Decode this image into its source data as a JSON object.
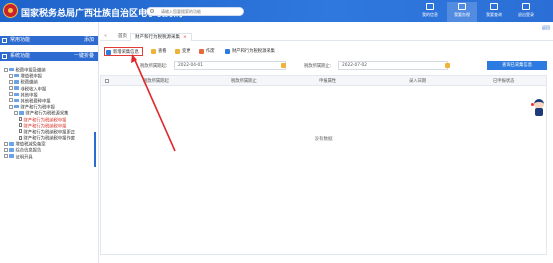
{
  "header": {
    "title": "国家税务总局广西壮族自治区电子税务局",
    "search_placeholder": "请输入您要搜索的功能",
    "buttons": [
      {
        "label": "我的信息"
      },
      {
        "label": "我要办税"
      },
      {
        "label": "我要查询"
      },
      {
        "label": "退出登录"
      }
    ]
  },
  "exit_label": "返回",
  "sidebar": {
    "common_label": "常用功能",
    "common_action": "添加",
    "system_label": "系统功能",
    "system_action": "一键折叠",
    "tree": [
      {
        "label": "税费申报及缴纳",
        "kind": "folder",
        "level": 0
      },
      {
        "label": "增值税申报",
        "kind": "folder",
        "level": 1
      },
      {
        "label": "税费缴纳",
        "kind": "folder",
        "level": 1
      },
      {
        "label": "非税收入申报",
        "kind": "folder",
        "level": 1
      },
      {
        "label": "其他申报",
        "kind": "folder",
        "level": 1
      },
      {
        "label": "其他税费种申报",
        "kind": "folder",
        "level": 1
      },
      {
        "label": "财产和行为税申报",
        "kind": "folder",
        "level": 1
      },
      {
        "label": "财产和行为税税源采集",
        "kind": "folder",
        "level": 2
      },
      {
        "label": "财产和行为税纳税申报",
        "kind": "doc",
        "level": 3,
        "red": true
      },
      {
        "label": "财产和行为税纳税申报",
        "kind": "doc",
        "level": 3,
        "red": true
      },
      {
        "label": "财产和行为税纳税申报更正",
        "kind": "doc",
        "level": 3
      },
      {
        "label": "财产和行为税纳税申报作废",
        "kind": "doc",
        "level": 3
      },
      {
        "label": "增值税减免备案",
        "kind": "folder",
        "level": 0
      },
      {
        "label": "综合信息报告",
        "kind": "folder",
        "level": 0
      },
      {
        "label": "证明开具",
        "kind": "folder",
        "level": 0
      }
    ]
  },
  "tabs": {
    "home": "首页",
    "current": "财产和行为税税源采集"
  },
  "toolbar": {
    "buttons": [
      {
        "label": "新增采集信息",
        "color": "#2d7be0"
      },
      {
        "label": "查看",
        "color": "#f0b33a"
      },
      {
        "label": "变更",
        "color": "#f0b33a"
      },
      {
        "label": "作废",
        "color": "#e86a3c"
      },
      {
        "label": "财产和行为税税源采集",
        "color": "#2d7be0"
      }
    ]
  },
  "filters": {
    "start_label": "税款所属期起:",
    "start_value": "2022-04-01",
    "end_label": "税款所属期止:",
    "end_value": "2022-07-02",
    "query_button": "查询已采集信息"
  },
  "table": {
    "columns": [
      "税款所属期起",
      "税款所属期止",
      "申报属性",
      "录入日期",
      "已申报状态"
    ],
    "empty_text": "没有数据"
  }
}
